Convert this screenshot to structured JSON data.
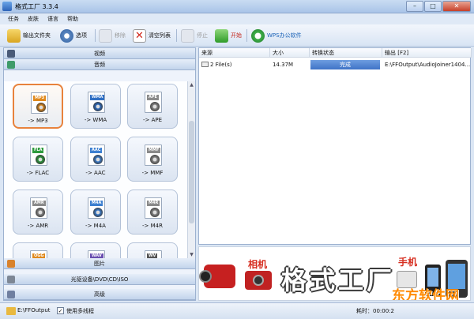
{
  "window": {
    "title": "格式工厂 3.3.4"
  },
  "menu": [
    "任务",
    "皮肤",
    "语言",
    "帮助"
  ],
  "toolbar": {
    "output_folder": "输出文件夹",
    "options": "选项",
    "remove": "移除",
    "clear_list": "清空列表",
    "stop": "停止",
    "start": "开始",
    "wps": "WPS办公软件"
  },
  "categories": {
    "video": "视频",
    "audio": "音频",
    "picture": "图片",
    "optical": "光驱设备\\DVD\\CD\\ISO",
    "advanced": "高级"
  },
  "formats": [
    {
      "tag": "MP3",
      "label": "-> MP3",
      "color": "#e08a1e",
      "selected": true
    },
    {
      "tag": "WMA",
      "label": "-> WMA",
      "color": "#2f6fc4",
      "selected": false
    },
    {
      "tag": "APE",
      "label": "-> APE",
      "color": "#8a8a8a",
      "selected": false
    },
    {
      "tag": "FLA",
      "label": "-> FLAC",
      "color": "#2e9b3e",
      "selected": false
    },
    {
      "tag": "AAC",
      "label": "-> AAC",
      "color": "#3c7fd0",
      "selected": false
    },
    {
      "tag": "MMF",
      "label": "-> MMF",
      "color": "#8a8a8a",
      "selected": false
    },
    {
      "tag": "AMR",
      "label": "-> AMR",
      "color": "#8a8a8a",
      "selected": false
    },
    {
      "tag": "M4A",
      "label": "-> M4A",
      "color": "#3c7fd0",
      "selected": false
    },
    {
      "tag": "M4R",
      "label": "-> M4R",
      "color": "#8a8a8a",
      "selected": false
    },
    {
      "tag": "OGG",
      "label": "",
      "color": "#e08a1e",
      "selected": false
    },
    {
      "tag": "WAV",
      "label": "",
      "color": "#6a4fb0",
      "selected": false
    },
    {
      "tag": "WV",
      "label": "",
      "color": "#555555",
      "selected": false
    }
  ],
  "table": {
    "headers": [
      "来源",
      "大小",
      "转换状态",
      "输出 [F2]"
    ],
    "rows": [
      {
        "source": "2 File(s)",
        "size": "14.37M",
        "status": "完成",
        "output": "E:\\FFOutput\\AudioJoiner1404..."
      }
    ]
  },
  "banner": {
    "title": "格式工厂",
    "sub_camera": "相机",
    "sub_phone": "手机",
    "watermark": "东方软件网"
  },
  "status": {
    "path": "E:\\FFOutput",
    "multithread_checked": true,
    "multithread_label": "使用多线程",
    "elapsed": "耗时：00:00:2"
  },
  "colors": {
    "accent": "#3f73c7",
    "selected_border": "#e8823c",
    "title_red": "#d62d1f"
  }
}
